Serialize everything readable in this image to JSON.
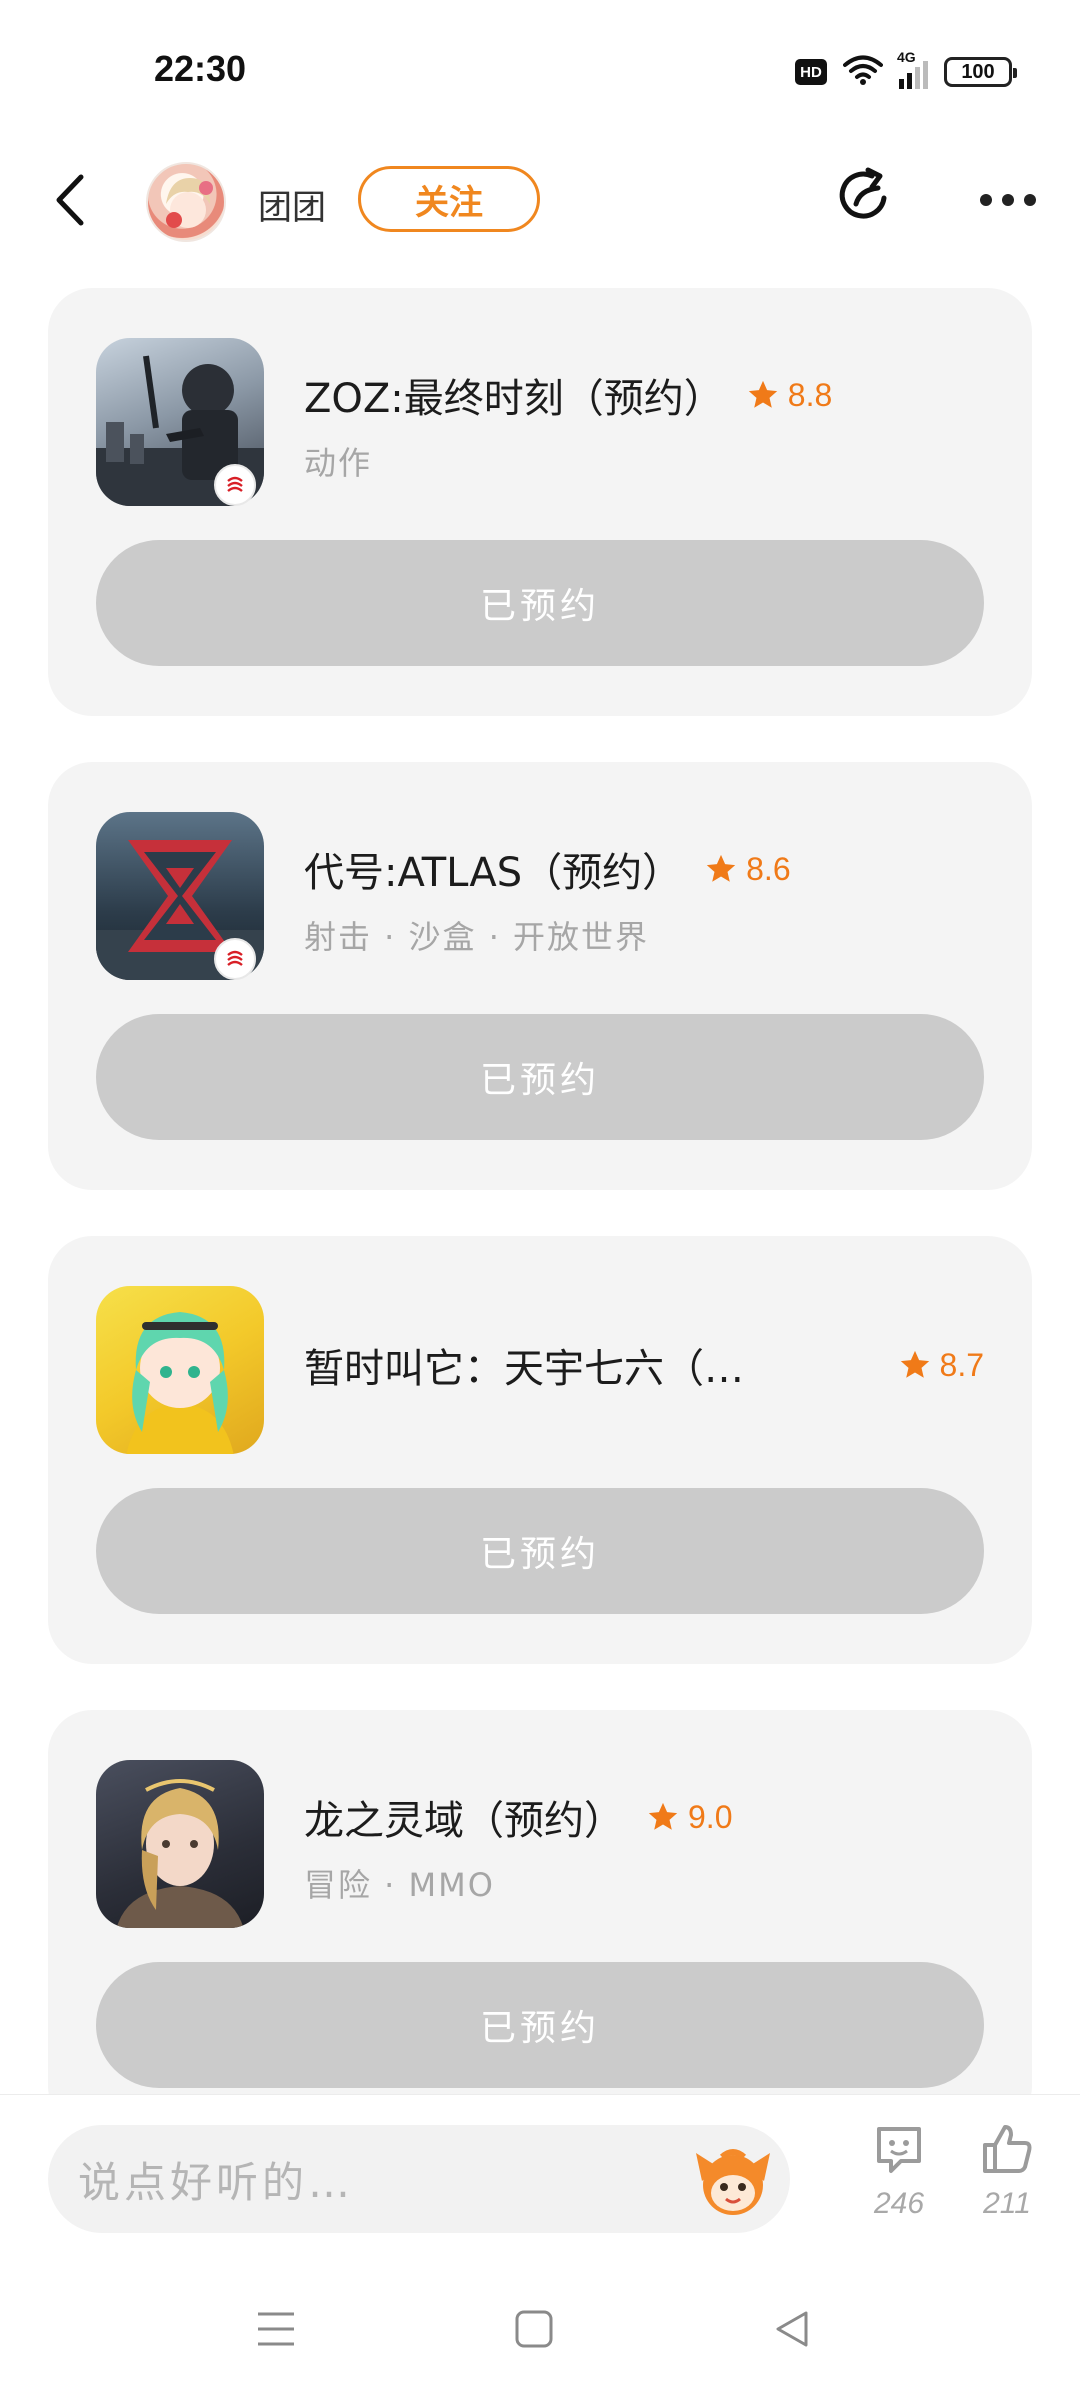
{
  "status_bar": {
    "time": "22:30",
    "hd_label": "HD",
    "network": "4G",
    "battery": "100",
    "icons": [
      "hd-icon",
      "wifi-icon",
      "signal-icon",
      "battery-icon"
    ]
  },
  "header": {
    "user_name": "团团",
    "follow_label": "关注",
    "icons": [
      "back-icon",
      "share-icon",
      "more-icon"
    ]
  },
  "colors": {
    "accent": "#f0871f",
    "rating": "#f07a18",
    "card_bg": "#f4f4f4",
    "button_disabled": "#cbcbcb"
  },
  "games": [
    {
      "title": "ZOZ:最终时刻（预约）",
      "rating": "8.8",
      "tags": "动作",
      "button_label": "已预约",
      "icon": "zoz-game-icon",
      "publisher_badge": "netease-icon"
    },
    {
      "title": "代号:ATLAS（预约）",
      "rating": "8.6",
      "tags": "射击 · 沙盒 · 开放世界",
      "button_label": "已预约",
      "icon": "atlas-game-icon",
      "publisher_badge": "netease-icon"
    },
    {
      "title": "暂时叫它：天宇七六（…",
      "rating": "8.7",
      "tags": "",
      "button_label": "已预约",
      "icon": "anime-game-icon"
    },
    {
      "title": "龙之灵域（预约）",
      "rating": "9.0",
      "tags": "冒险 · MMO",
      "button_label": "已预约",
      "icon": "dragon-game-icon"
    }
  ],
  "comment_bar": {
    "placeholder": "说点好听的…",
    "comment_count": "246",
    "like_count": "211"
  },
  "nav": [
    "menu-icon",
    "home-icon",
    "back-nav-icon"
  ]
}
